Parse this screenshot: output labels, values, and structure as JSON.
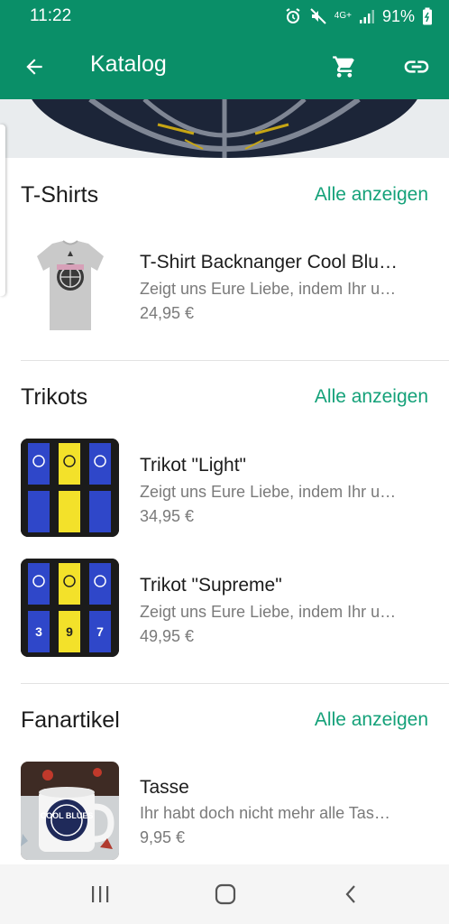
{
  "status_bar": {
    "time": "11:22",
    "battery": "91%",
    "network": "4G+"
  },
  "app_bar": {
    "title": "Katalog"
  },
  "sections": [
    {
      "title": "T-Shirts",
      "show_all": "Alle anzeigen",
      "products": [
        {
          "name": "T-Shirt Backnanger Cool Blu…",
          "desc": "Zeigt uns Eure Liebe, indem Ihr u…",
          "price": "24,95 €"
        }
      ]
    },
    {
      "title": "Trikots",
      "show_all": "Alle anzeigen",
      "products": [
        {
          "name": "Trikot \"Light\"",
          "desc": "Zeigt uns Eure Liebe, indem Ihr u…",
          "price": "34,95 €"
        },
        {
          "name": "Trikot \"Supreme\"",
          "desc": "Zeigt uns Eure Liebe, indem Ihr u…",
          "price": "49,95 €"
        }
      ]
    },
    {
      "title": "Fanartikel",
      "show_all": "Alle anzeigen",
      "products": [
        {
          "name": "Tasse",
          "desc": "Ihr habt doch nicht mehr alle Tas…",
          "price": "9,95 €"
        }
      ]
    }
  ],
  "thumbnails": {
    "jersey_numbers": [
      "3",
      "9",
      "7"
    ],
    "mug_text": "COOL BLUES"
  },
  "colors": {
    "primary": "#0a8f68",
    "accent": "#14a179"
  }
}
